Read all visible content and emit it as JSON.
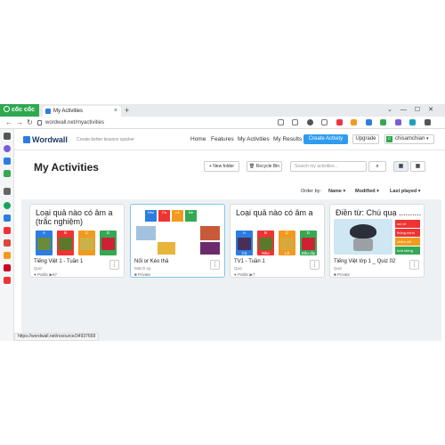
{
  "browser": {
    "brand": "cốc cốc",
    "tab_title": "My Activities",
    "url": "wordwall.net/myactivities",
    "status_url": "https://wordwall.net/resource/34937669"
  },
  "header": {
    "logo": "Wordwall",
    "tagline": "Create better lessons quicker",
    "nav": [
      "Home",
      "Features",
      "My Activities",
      "My Results"
    ],
    "create_label": "Create Activity",
    "upgrade_label": "Upgrade",
    "user_name": "chisamchian",
    "user_initial": "c"
  },
  "page": {
    "title": "My Activities",
    "new_folder": "+ New folder",
    "recycle_bin": "Recycle Bin",
    "search_placeholder": "Search my activities...",
    "order_by_label": "Order by:",
    "order_options": [
      "Name",
      "Modified",
      "Last played"
    ]
  },
  "cards": [
    {
      "thumb_title": "Loại quả nào có âm a (trắc nghiệm)",
      "name": "Tiếng Việt 1 - Tuần 1",
      "type": "Quiz",
      "visibility": "Public",
      "plays": "67",
      "letters": [
        "A",
        "B",
        "C",
        "D"
      ]
    },
    {
      "thumb_title": "",
      "name": "Nối or Kéo thả",
      "type": "Match up",
      "visibility": "Private",
      "plays": "",
      "labels": [
        "Nho",
        "Cà",
        "Lê",
        "Me"
      ]
    },
    {
      "thumb_title": "Loại quả nào có âm a",
      "name": "TV1 - Tuần 1",
      "type": "Quiz",
      "visibility": "Public",
      "plays": "7",
      "letters": [
        "A",
        "B",
        "C",
        "D"
      ],
      "answers": [
        "Cà",
        "Nho",
        "Lê",
        "Đầu tây"
      ]
    },
    {
      "thumb_title": "Điền từ: Chú quạ ..........",
      "name": "Tiếng Việt lớp 1 _ Quiz 02",
      "type": "Quiz",
      "visibility": "Private",
      "plays": "",
      "answers": [
        "xui về",
        "thông minh",
        "chăm chỉ",
        "lười biếng"
      ]
    }
  ]
}
